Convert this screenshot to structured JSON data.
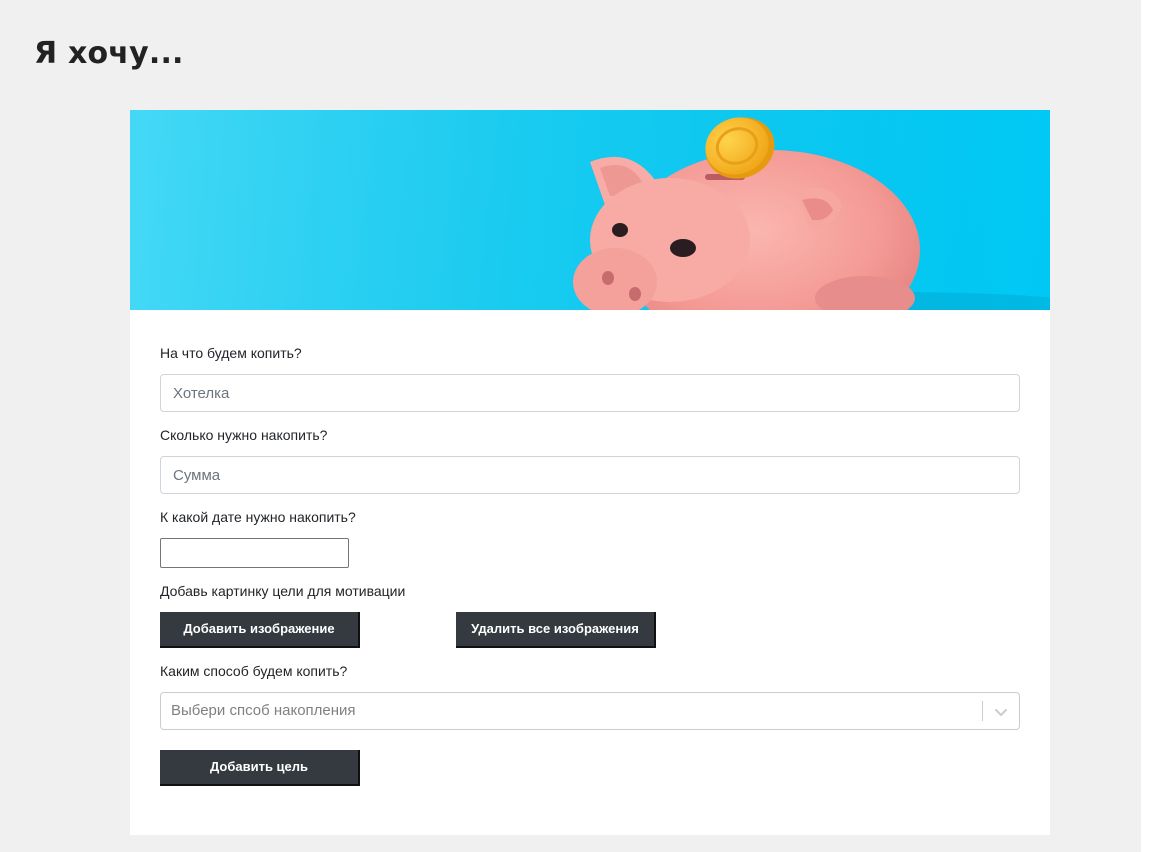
{
  "page": {
    "title": "Я хочу..."
  },
  "hero": {
    "image": "piggy-bank-with-coin",
    "colors": {
      "background": "#00c8f5",
      "pig": "#f59b9b",
      "coin": "#f7b52a"
    }
  },
  "form": {
    "goal": {
      "label": "На что будем копить?",
      "placeholder": "Хотелка",
      "value": ""
    },
    "amount": {
      "label": "Сколько нужно накопить?",
      "placeholder": "Сумма",
      "value": ""
    },
    "date": {
      "label": "К какой дате нужно накопить?",
      "value": ""
    },
    "images": {
      "label": "Добавь картинку цели для мотивации",
      "add_button": "Добавить изображение",
      "remove_all_button": "Удалить все изображения"
    },
    "method": {
      "label": "Каким способ будем копить?",
      "placeholder": "Выбери спсоб накопления",
      "chevron_icon": "chevron-down-icon"
    },
    "submit_button": "Добавить цель"
  },
  "colors": {
    "page_background": "#f0f0f0",
    "card_background": "#ffffff",
    "button_background": "#343a40",
    "button_text": "#ffffff"
  }
}
